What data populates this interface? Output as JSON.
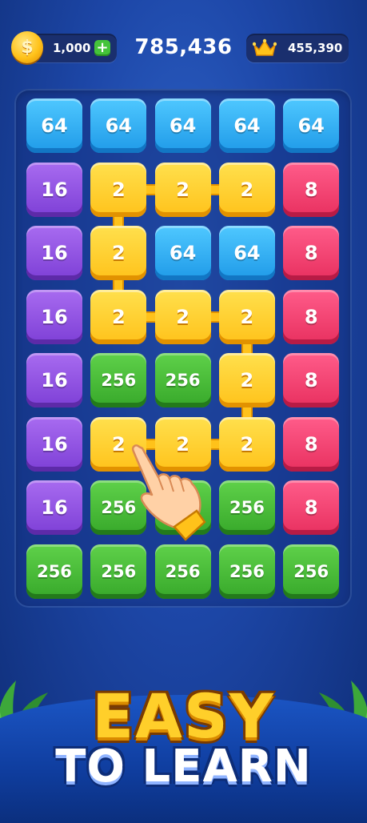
{
  "hud": {
    "coins": "1,000",
    "coin_symbol": "$",
    "plus_label": "+",
    "score": "785,436",
    "best_score": "455,390",
    "crown_icon": "crown-icon"
  },
  "board": {
    "rows": [
      [
        {
          "v": "64",
          "c": "blue"
        },
        {
          "v": "64",
          "c": "blue"
        },
        {
          "v": "64",
          "c": "blue"
        },
        {
          "v": "64",
          "c": "blue"
        },
        {
          "v": "64",
          "c": "blue"
        }
      ],
      [
        {
          "v": "16",
          "c": "purple"
        },
        {
          "v": "2",
          "c": "yellow"
        },
        {
          "v": "2",
          "c": "yellow"
        },
        {
          "v": "2",
          "c": "yellow"
        },
        {
          "v": "8",
          "c": "pink"
        }
      ],
      [
        {
          "v": "16",
          "c": "purple"
        },
        {
          "v": "2",
          "c": "yellow"
        },
        {
          "v": "64",
          "c": "blue"
        },
        {
          "v": "64",
          "c": "blue"
        },
        {
          "v": "8",
          "c": "pink"
        }
      ],
      [
        {
          "v": "16",
          "c": "purple"
        },
        {
          "v": "2",
          "c": "yellow"
        },
        {
          "v": "2",
          "c": "yellow"
        },
        {
          "v": "2",
          "c": "yellow"
        },
        {
          "v": "8",
          "c": "pink"
        }
      ],
      [
        {
          "v": "16",
          "c": "purple"
        },
        {
          "v": "256",
          "c": "green"
        },
        {
          "v": "256",
          "c": "green"
        },
        {
          "v": "2",
          "c": "yellow"
        },
        {
          "v": "8",
          "c": "pink"
        }
      ],
      [
        {
          "v": "16",
          "c": "purple"
        },
        {
          "v": "2",
          "c": "yellow"
        },
        {
          "v": "2",
          "c": "yellow"
        },
        {
          "v": "2",
          "c": "yellow"
        },
        {
          "v": "8",
          "c": "pink"
        }
      ],
      [
        {
          "v": "16",
          "c": "purple"
        },
        {
          "v": "256",
          "c": "green"
        },
        {
          "v": "256",
          "c": "green"
        },
        {
          "v": "256",
          "c": "green"
        },
        {
          "v": "8",
          "c": "pink"
        }
      ],
      [
        {
          "v": "256",
          "c": "green"
        },
        {
          "v": "256",
          "c": "green"
        },
        {
          "v": "256",
          "c": "green"
        },
        {
          "v": "256",
          "c": "green"
        },
        {
          "v": "256",
          "c": "green"
        }
      ]
    ],
    "links": [
      {
        "r": 1,
        "c": 1,
        "dir": "h"
      },
      {
        "r": 1,
        "c": 2,
        "dir": "h"
      },
      {
        "r": 1,
        "c": 1,
        "dir": "v"
      },
      {
        "r": 2,
        "c": 1,
        "dir": "v"
      },
      {
        "r": 3,
        "c": 1,
        "dir": "h"
      },
      {
        "r": 3,
        "c": 2,
        "dir": "h"
      },
      {
        "r": 3,
        "c": 3,
        "dir": "v"
      },
      {
        "r": 4,
        "c": 3,
        "dir": "v"
      },
      {
        "r": 5,
        "c": 2,
        "dir": "h"
      },
      {
        "r": 5,
        "c": 1,
        "dir": "h"
      }
    ]
  },
  "banner": {
    "line1": "EASY",
    "line2": "TO LEARN"
  },
  "colors": {
    "blue": "#2aaaf2",
    "purple": "#8d4fe0",
    "yellow": "#ffc21a",
    "pink": "#ee3a6a",
    "green": "#44b834"
  }
}
